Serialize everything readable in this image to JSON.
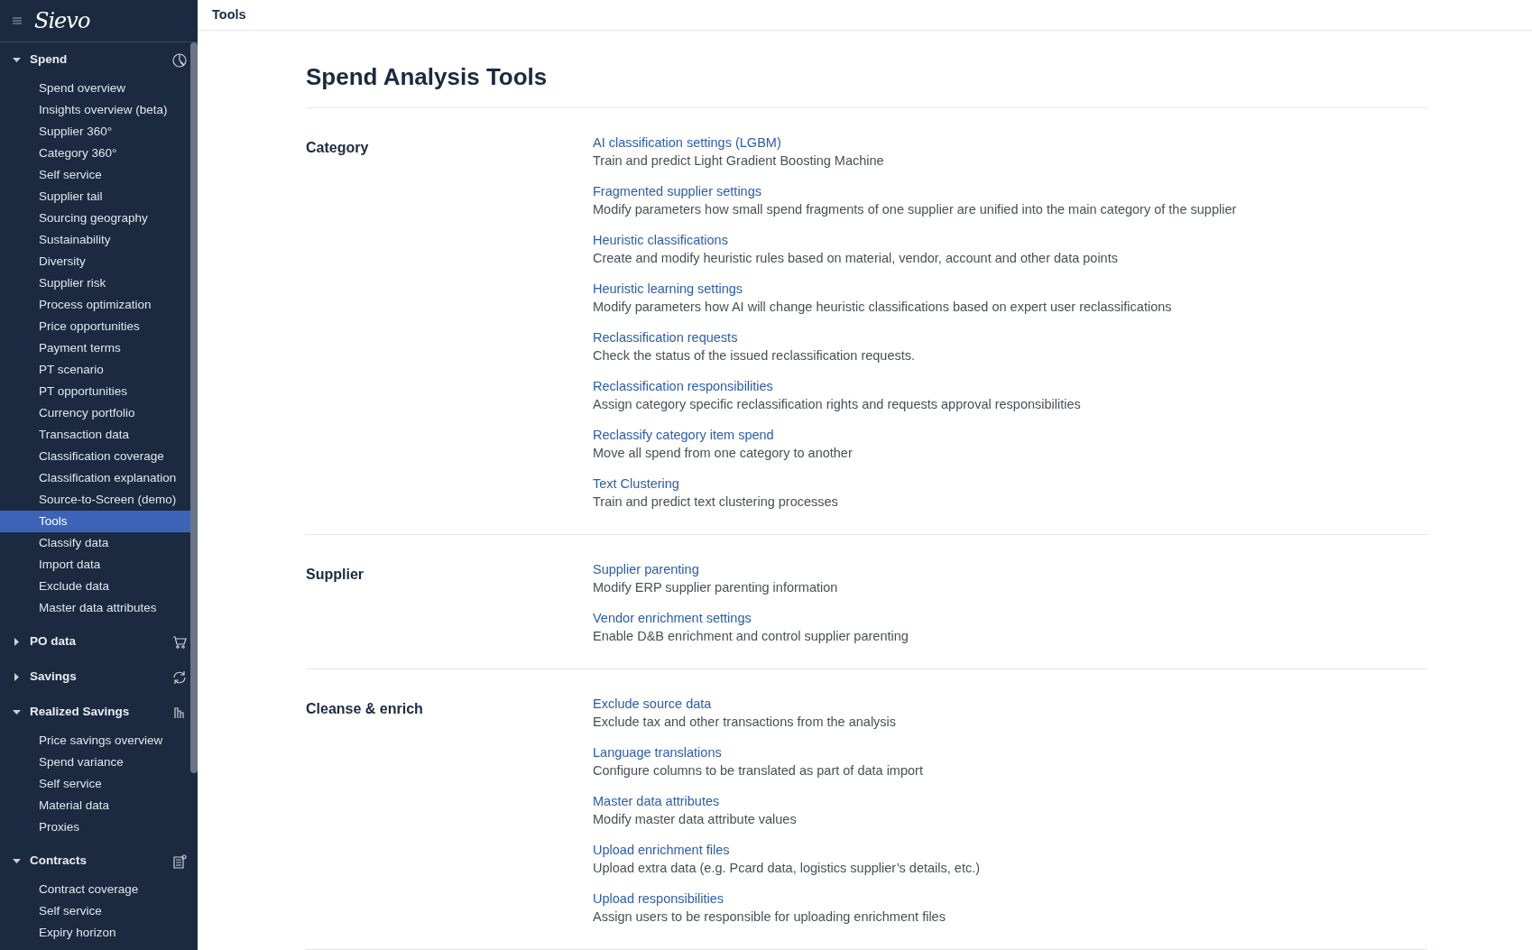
{
  "app": {
    "logo": "Sievo",
    "page_title": "Tools"
  },
  "sidebar": {
    "groups": [
      {
        "title": "Spend",
        "kind": "pie",
        "expanded": true,
        "items": [
          {
            "label": "Spend overview",
            "selected": false
          },
          {
            "label": "Insights overview (beta)",
            "selected": false
          },
          {
            "label": "Supplier 360°",
            "selected": false
          },
          {
            "label": "Category 360°",
            "selected": false
          },
          {
            "label": "Self service",
            "selected": false
          },
          {
            "label": "Supplier tail",
            "selected": false
          },
          {
            "label": "Sourcing geography",
            "selected": false
          },
          {
            "label": "Sustainability",
            "selected": false
          },
          {
            "label": "Diversity",
            "selected": false
          },
          {
            "label": "Supplier risk",
            "selected": false
          },
          {
            "label": "Process optimization",
            "selected": false
          },
          {
            "label": "Price opportunities",
            "selected": false
          },
          {
            "label": "Payment terms",
            "selected": false
          },
          {
            "label": "PT scenario",
            "selected": false
          },
          {
            "label": "PT opportunities",
            "selected": false
          },
          {
            "label": "Currency portfolio",
            "selected": false
          },
          {
            "label": "Transaction data",
            "selected": false
          },
          {
            "label": "Classification coverage",
            "selected": false
          },
          {
            "label": "Classification explanation",
            "selected": false
          },
          {
            "label": "Source-to-Screen (demo)",
            "selected": false
          },
          {
            "label": "Tools",
            "selected": true
          },
          {
            "label": "Classify data",
            "selected": false
          },
          {
            "label": "Import data",
            "selected": false
          },
          {
            "label": "Exclude data",
            "selected": false
          },
          {
            "label": "Master data attributes",
            "selected": false
          }
        ]
      },
      {
        "title": "PO data",
        "kind": "cart",
        "expanded": false
      },
      {
        "title": "Savings",
        "kind": "refresh",
        "expanded": false
      },
      {
        "title": "Realized Savings",
        "kind": "bars",
        "expanded": true,
        "items": [
          {
            "label": "Price savings overview",
            "selected": false
          },
          {
            "label": "Spend variance",
            "selected": false
          },
          {
            "label": "Self service",
            "selected": false
          },
          {
            "label": "Material data",
            "selected": false
          },
          {
            "label": "Proxies",
            "selected": false
          }
        ]
      },
      {
        "title": "Contracts",
        "kind": "document",
        "expanded": true,
        "items": [
          {
            "label": "Contract coverage",
            "selected": false
          },
          {
            "label": "Self service",
            "selected": false
          },
          {
            "label": "Expiry horizon",
            "selected": false
          }
        ]
      }
    ]
  },
  "main": {
    "heading": "Spend Analysis Tools",
    "sections": [
      {
        "title": "Category",
        "tools": [
          {
            "link": "AI classification settings (LGBM)",
            "description": "Train and predict Light Gradient Boosting Machine"
          },
          {
            "link": "Fragmented supplier settings",
            "description": "Modify parameters how small spend fragments of one supplier are unified into the main category of the supplier"
          },
          {
            "link": "Heuristic classifications",
            "description": "Create and modify heuristic rules based on material, vendor, account and other data points"
          },
          {
            "link": "Heuristic learning settings",
            "description": "Modify parameters how AI will change heuristic classifications based on expert user reclassifications"
          },
          {
            "link": "Reclassification requests",
            "description": "Check the status of the issued reclassification requests."
          },
          {
            "link": "Reclassification responsibilities",
            "description": "Assign category specific reclassification rights and requests approval responsibilities"
          },
          {
            "link": "Reclassify category item spend",
            "description": "Move all spend from one category to another"
          },
          {
            "link": "Text Clustering",
            "description": "Train and predict text clustering processes"
          }
        ]
      },
      {
        "title": "Supplier",
        "tools": [
          {
            "link": "Supplier parenting",
            "description": "Modify ERP supplier parenting information"
          },
          {
            "link": "Vendor enrichment settings",
            "description": "Enable D&B enrichment and control supplier parenting"
          }
        ]
      },
      {
        "title": "Cleanse & enrich",
        "tools": [
          {
            "link": "Exclude source data",
            "description": "Exclude tax and other transactions from the analysis"
          },
          {
            "link": "Language translations",
            "description": "Configure columns to be translated as part of data import"
          },
          {
            "link": "Master data attributes",
            "description": "Modify master data attribute values"
          },
          {
            "link": "Upload enrichment files",
            "description": "Upload extra data (e.g. Pcard data, logistics supplier’s details, etc.)"
          },
          {
            "link": "Upload responsibilities",
            "description": "Assign users to be responsible for uploading enrichment files"
          }
        ]
      }
    ]
  }
}
